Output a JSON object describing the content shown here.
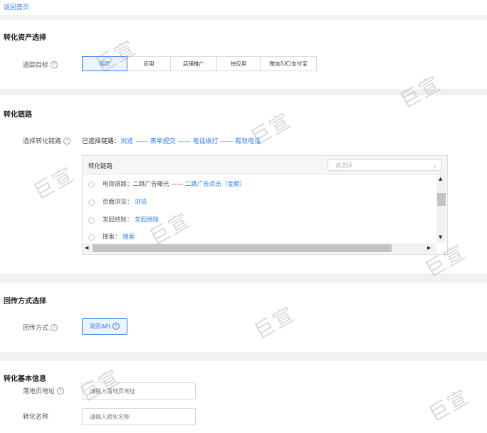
{
  "back_link": "返回首页",
  "asset_section": {
    "title": "转化资产选择",
    "track_label": "追踪目标",
    "options": [
      "网页",
      "应用",
      "店铺推广",
      "快应用",
      "微信/UC/支付宝"
    ]
  },
  "link_section": {
    "title": "转化链路",
    "select_label": "选择转化链路",
    "selected_prefix": "已选择链路：",
    "selected_chain": "浏览 —— 表单提交 —— 电话拨打 —— 有效电话",
    "panel": {
      "header": "转化链路",
      "select_placeholder": "请选择",
      "rows": [
        {
          "label": "电商链路：",
          "plain": "二跳广告曝光 ——",
          "link": "二跳广告点击（金额）"
        },
        {
          "label": "页面浏览：",
          "plain": "",
          "link": "浏览"
        },
        {
          "label": "发起结账：",
          "plain": "",
          "link": "发起结账"
        },
        {
          "label": "搜索：",
          "plain": "",
          "link": "搜索"
        }
      ]
    }
  },
  "return_section": {
    "title": "回传方式选择",
    "method_label": "回传方式",
    "method_button": "网页API"
  },
  "basic_section": {
    "title": "转化基本信息",
    "url_label": "落地页地址",
    "url_placeholder": "请输入落地页地址",
    "name_label": "转化名称",
    "name_placeholder": "请输入转化名称"
  },
  "watermark": "巨宣",
  "colors": {
    "accent": "#2f7ef6",
    "page_bg": "#f0f1f3"
  }
}
